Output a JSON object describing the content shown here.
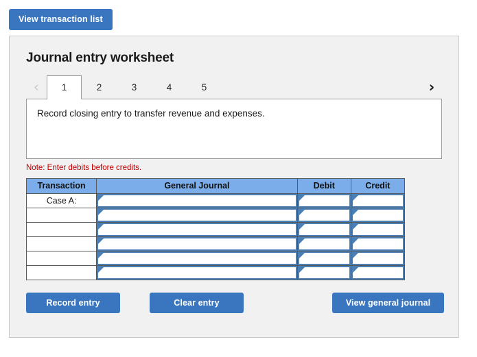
{
  "toolbar": {
    "view_transaction_list_label": "View transaction list"
  },
  "panel": {
    "title": "Journal entry worksheet",
    "prev_icon": "chevron-left-icon",
    "next_icon": "chevron-right-icon",
    "prev_glyph": "‹",
    "next_glyph": "›",
    "tabs": [
      {
        "label": "1",
        "active": true
      },
      {
        "label": "2",
        "active": false
      },
      {
        "label": "3",
        "active": false
      },
      {
        "label": "4",
        "active": false
      },
      {
        "label": "5",
        "active": false
      }
    ],
    "description": "Record closing entry to transfer revenue and expenses.",
    "note": "Note: Enter debits before credits."
  },
  "table": {
    "headers": [
      "Transaction",
      "General Journal",
      "Debit",
      "Credit"
    ],
    "rows": [
      {
        "transaction": "Case A:",
        "general_journal": "",
        "debit": "",
        "credit": ""
      },
      {
        "transaction": "",
        "general_journal": "",
        "debit": "",
        "credit": ""
      },
      {
        "transaction": "",
        "general_journal": "",
        "debit": "",
        "credit": ""
      },
      {
        "transaction": "",
        "general_journal": "",
        "debit": "",
        "credit": ""
      },
      {
        "transaction": "",
        "general_journal": "",
        "debit": "",
        "credit": ""
      },
      {
        "transaction": "",
        "general_journal": "",
        "debit": "",
        "credit": ""
      }
    ]
  },
  "actions": {
    "record_entry_label": "Record entry",
    "clear_entry_label": "Clear entry",
    "view_general_journal_label": "View general journal"
  },
  "colors": {
    "button_blue": "#3a76c0",
    "table_header_blue": "#7aadea",
    "input_border_blue": "#4a7fb5",
    "note_red": "#c00000",
    "panel_bg": "#f1f1f1"
  }
}
